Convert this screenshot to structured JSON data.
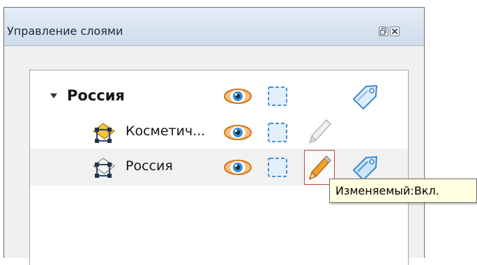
{
  "panel": {
    "title": "Управление слоями",
    "buttons": {
      "float_icon": "float-icon",
      "close_icon": "close-icon"
    }
  },
  "tree": {
    "group": {
      "label": "Россия",
      "expanded": true,
      "icons": [
        "expand-arrow-icon",
        "eye-icon",
        "selection-box-icon",
        "label-tag-icon"
      ]
    },
    "layers": [
      {
        "label": "Косметич...",
        "icons": [
          "cosmetic-layer-icon",
          "eye-icon",
          "selection-box-icon",
          "pencil-icon"
        ],
        "editable": false,
        "selected": false
      },
      {
        "label": "Россия",
        "icons": [
          "map-layer-icon",
          "eye-icon",
          "selection-box-icon",
          "pencil-icon",
          "label-tag-icon"
        ],
        "editable": true,
        "selected": true
      }
    ]
  },
  "tooltip": {
    "text": "Изменяемый:Вкл."
  },
  "colors": {
    "titlebar": "#d6e2ef",
    "selection_box": "#4a8fd8",
    "eye_iris": "#3c8ed0",
    "eye_outer": "#e07a1e",
    "pencil_active": "#e89a28",
    "highlight_border": "#c04848",
    "tag": "#5aa2e0",
    "tooltip_bg": "#ffffe1"
  }
}
